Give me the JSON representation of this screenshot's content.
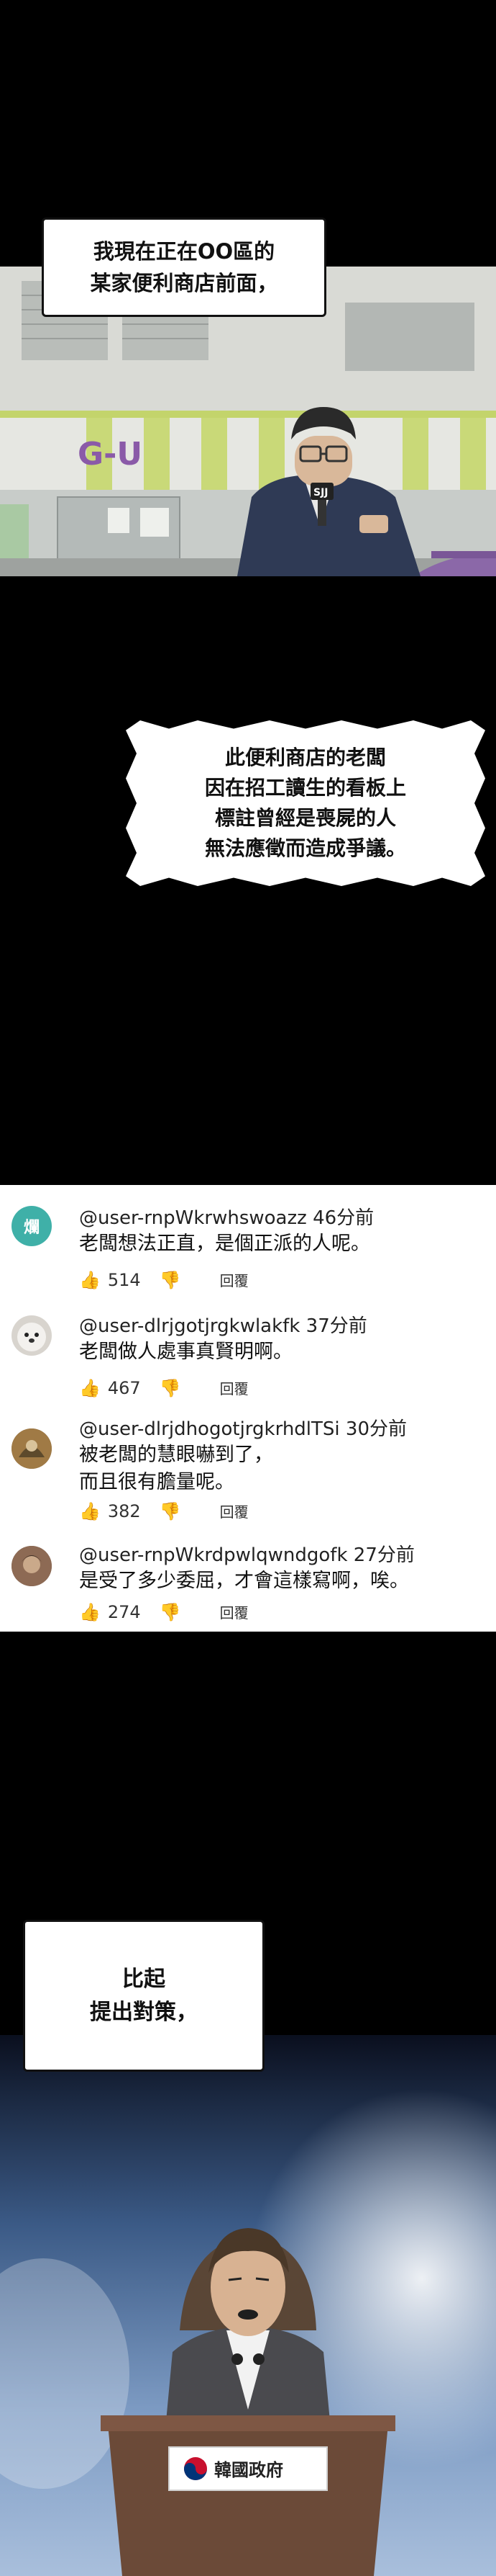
{
  "panel1": {
    "bubble_top": [
      "我現在正在OO區的",
      "某家便利商店前面，"
    ],
    "store_sign": "G-U",
    "mic_label": "SJJ",
    "bubble_bottom": [
      "此便利商店的老闆",
      "因在招工讀生的看板上",
      "標註曾經是喪屍的人",
      "無法應徵而造成爭議。"
    ]
  },
  "comments": [
    {
      "avatar_text": "爛",
      "avatar_color": "#3fb0a8",
      "user": "@user-rnpWkrwhswoazz",
      "time": "46分前",
      "lines": [
        "老闆想法正直，是個正派的人呢。"
      ],
      "likes": "514",
      "reply": "回覆"
    },
    {
      "avatar_text": "",
      "avatar_color": "#cfcac4",
      "user": "@user-dlrjgotjrgkwlakfk",
      "time": "37分前",
      "lines": [
        "老闆做人處事真賢明啊。"
      ],
      "likes": "467",
      "reply": "回覆"
    },
    {
      "avatar_text": "",
      "avatar_color": "#8a6b3f",
      "user": "@user-dlrjdhogotjrgkrhdlTSi",
      "time": "30分前",
      "lines": [
        "被老闆的慧眼嚇到了，",
        "而且很有膽量呢。"
      ],
      "likes": "382",
      "reply": "回覆"
    },
    {
      "avatar_text": "",
      "avatar_color": "#7a5a48",
      "user": "@user-rnpWkrdpwlqwndgofk",
      "time": "27分前",
      "lines": [
        "是受了多少委屈，才會這樣寫啊，唉。"
      ],
      "likes": "274",
      "reply": "回覆"
    }
  ],
  "panel2": {
    "bubble": [
      "比起",
      "提出對策，"
    ],
    "podium_label": "韓國政府"
  }
}
